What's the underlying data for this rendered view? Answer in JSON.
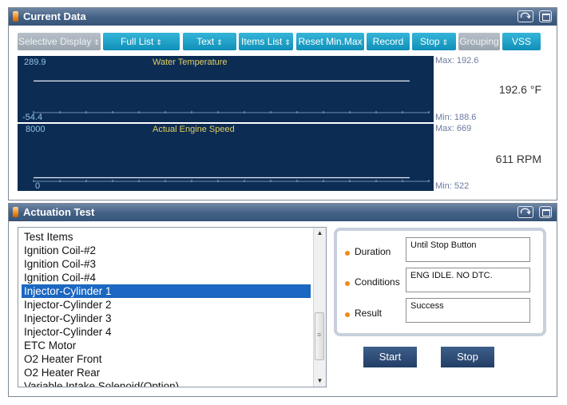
{
  "current_data": {
    "title": "Current Data",
    "toolbar": {
      "selective_display": "Selective Display",
      "full_list": "Full List",
      "text": "Text",
      "items_list": "Items List",
      "reset_minmax": "Reset Min.Max",
      "record": "Record",
      "stop": "Stop",
      "grouping": "Grouping",
      "vss": "VSS"
    },
    "graphs": [
      {
        "name": "Water Temperature",
        "y_max_label": "289.9",
        "y_min_label": "-54.4",
        "max_text": "Max: 192.6",
        "min_text": "Min: 188.6",
        "current": "192.6 °F",
        "level": 0.72
      },
      {
        "name": "Actual Engine Speed",
        "y_max_label": "8000",
        "y_min_label": "0",
        "max_text": "Max: 669",
        "min_text": "Min: 522",
        "current": "611 RPM",
        "level": 0.08
      }
    ]
  },
  "actuation_test": {
    "title": "Actuation Test",
    "list_header": "Test Items",
    "items": [
      "Ignition Coil-#2",
      "Ignition Coil-#3",
      "Ignition Coil-#4",
      "Injector-Cylinder 1",
      "Injector-Cylinder 2",
      "Injector-Cylinder 3",
      "Injector-Cylinder 4",
      "ETC Motor",
      "O2 Heater Front",
      "O2 Heater Rear",
      "Variable Intake Solenoid(Option)"
    ],
    "selected_item": "Injector-Cylinder 1",
    "info": {
      "duration_label": "Duration",
      "duration_value": "Until Stop Button",
      "conditions_label": "Conditions",
      "conditions_value": "ENG IDLE. NO DTC.",
      "result_label": "Result",
      "result_value": "Success"
    },
    "start_label": "Start",
    "stop_label": "Stop"
  },
  "icons": [
    "retry-icon",
    "maximize-icon",
    "orange-flag-icon",
    "bullet-icon",
    "scroll-up-icon",
    "scroll-down-icon"
  ],
  "colors": {
    "title_bar": "#425f84",
    "toolbar_button": "#1090b8",
    "graph_bg": "#0d2c54",
    "selection": "#1b67c1",
    "bullet": "#ee8a1a"
  }
}
